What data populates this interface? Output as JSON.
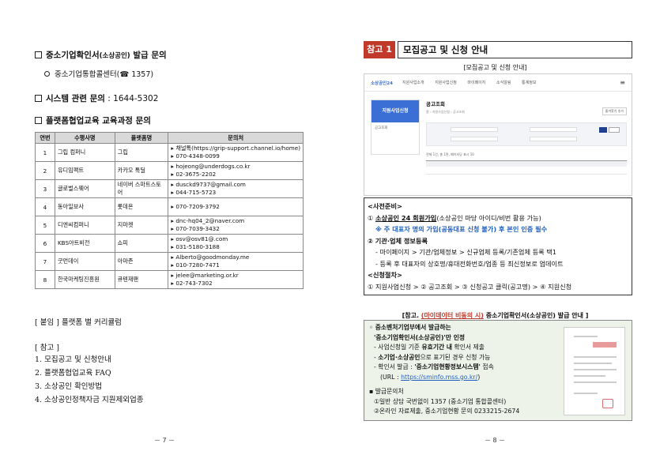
{
  "left_page": {
    "sec1_title": "중소기업확인서",
    "sec1_title_small": "(소상공인)",
    "sec1_title_tail": " 발급 문의",
    "sec1_sub": "중소기업통합콜센터(☎ 1357)",
    "sec2_title": "시스템 관련 문의",
    "sec2_value": " : 1644-5302",
    "sec3_title": "플랫폼협업교육 교육과정 문의",
    "table": {
      "headers": [
        "연번",
        "수행사명",
        "플랫폼명",
        "문의처"
      ],
      "rows": [
        {
          "no": "1",
          "company": "그립 컴퍼니",
          "platform": "그립",
          "contact": [
            "▸ 채널톡(https://grip-support.channel.io/home)",
            "▸ 070-4348-0099"
          ]
        },
        {
          "no": "2",
          "company": "유디임팩트",
          "platform": "카카오 톡딜",
          "contact": [
            "▸ hojeong@underdogs.co.kr",
            "▸ 02-3675-2202"
          ]
        },
        {
          "no": "3",
          "company": "글로벌스웨어",
          "platform": "네이버 스마트스토어",
          "contact": [
            "▸ dusckd9737@gmail.com",
            "▸ 044-715-5723"
          ]
        },
        {
          "no": "4",
          "company": "동아일보사",
          "platform": "롯데온",
          "contact": [
            "▸ 070-7209-3792"
          ]
        },
        {
          "no": "5",
          "company": "디엔씨컴퍼니",
          "platform": "지마켓",
          "contact": [
            "▸ dnc-hq04_2@naver.com",
            "▸ 070-7039-3432"
          ]
        },
        {
          "no": "6",
          "company": "KBS아트비전",
          "platform": "쇼피",
          "contact": [
            "▸ osv@osv81@.com",
            "▸ 031-5180-3188"
          ]
        },
        {
          "no": "7",
          "company": "굿먼데이",
          "platform": "아마존",
          "contact": [
            "▸ Alberto@goodmonday.me",
            "▸ 010-7280-7471"
          ]
        },
        {
          "no": "8",
          "company": "한국마케팅진흥원",
          "platform": "큐텐재팬",
          "contact": [
            "▸ jelee@marketing.or.kr",
            "▸ 02-743-7302"
          ]
        }
      ]
    },
    "attachment": "[ 붙임 ] 플랫폼 별 커리큘럼",
    "ref_heading": "[ 참고 ]",
    "refs": [
      "1. 모집공고 및 신청안내",
      "2. 플랫폼협업교육 FAQ",
      "3. 소상공인 확인방법",
      "4. 소상공인정책자금 지원제외업종"
    ],
    "page_number": "－ 7 －"
  },
  "right_page": {
    "tag": "참고 1",
    "title": "모집공고 및 신청 안내",
    "caption1": "[모집공고 및 신청 안내]",
    "screenshot": {
      "logo": "소상공인24",
      "nav": [
        "지원사업소개",
        "지원사업신청",
        "마이페이지",
        "소식알림",
        "통계정보"
      ],
      "sidebar_title": "지원사업신청",
      "sidebar_item": "공고조회",
      "main_title": "공고조회",
      "crumb": "홈 › 지원사업신청 › 공고조회",
      "btn": "즐겨찾기 추가",
      "count": "전체 1건, 총 1면, 페이지당 표시  10"
    },
    "prep": {
      "heading": "<사전준비>",
      "l1_num": "① ",
      "l1_bold": "소상공인 24 회원가입",
      "l1_rest": "(소상공인 마당 아이디/비번 활용 가능)",
      "l2": "※ 주 대표자 명의 가입(공동대표 신청 불가) 후 본인 인증 필수",
      "l3": "② 기관·업체 정보등록",
      "l4": "- 마이페이지 > 기관/업체정보 > 신규업체 등록/기존업체 등록 택1",
      "l5": "- 등록 후 대표자의 상호명/휴대전화번호/업종 등 최신정보로 업데이트",
      "heading2": "<신청절차>",
      "l6": "① 지원사업신청 > ② 공고조회 > ③ 신청공고 클릭(공고명) > ④ 지원신청"
    },
    "caption2_a": "[참고. ",
    "caption2_red": "(마이데이터 비동의 시)",
    "caption2_b": " 중소기업확인서(소상공인) 발급 안내 ]",
    "help": {
      "l1": "◦ 중소벤처기업부에서 발급하는",
      "l2": "'중소기업확인서(소상공인)'만 인정",
      "l3_a": "- 사업신청일 기준 ",
      "l3_b": "유효기간 내",
      "l3_c": " 확인서 제출",
      "l4_a": "- ",
      "l4_b": "소기업·소상공인",
      "l4_c": "으로 표기된 경우 신청 가능",
      "l5_a": "- 확인서 발급 : ",
      "l5_b": "'중소기업현황정보시스템'",
      "l5_c": " 접속",
      "l6_a": "(URL : ",
      "l6_link": "https://sminfo.mss.go.kr/",
      "l6_b": ")",
      "l7": "▪ 발급문의처",
      "l8": "①일반 상담 국번없이 1357 (중소기업 통합콜센터)",
      "l9": "②온라인 자료제출, 중소기업현황 문의 0233215-2674"
    },
    "page_number": "－ 8 －"
  }
}
